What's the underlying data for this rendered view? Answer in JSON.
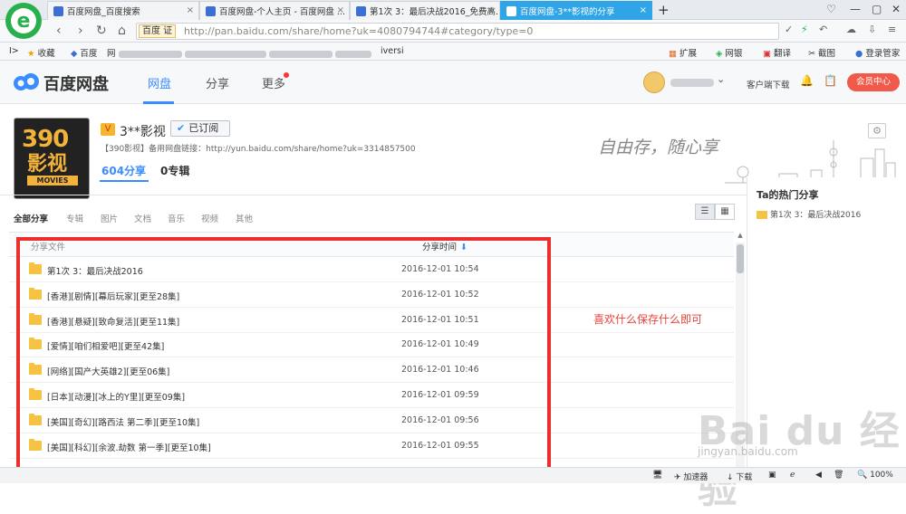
{
  "browser": {
    "tabs": [
      {
        "label": "百度网盘_百度搜索",
        "active": false
      },
      {
        "label": "百度网盘-个人主页 - 百度网盘 ...",
        "active": false
      },
      {
        "label": "第1次 3：最后决战2016_免费高...",
        "active": false
      },
      {
        "label": "百度网盘-3**影视的分享",
        "active": true
      }
    ],
    "new_tab": "+",
    "site_badge": "百度 证",
    "url": "http://pan.baidu.com/share/home?uk=4080794744#category/type=0",
    "bookmarks": {
      "toggle": "I>",
      "favorites": "收藏",
      "baidu": "百度",
      "net": "网",
      "universe": "iversi",
      "extensions": "扩展",
      "netbank": "网银",
      "translate": "翻译",
      "screenshot": "截图",
      "login_manager": "登录管家"
    }
  },
  "header": {
    "logo_text": "百度网盘",
    "nav": [
      "网盘",
      "分享",
      "更多"
    ],
    "client_download": "客户端下载",
    "vip_button": "会员中心"
  },
  "profile": {
    "cover_line1": "390",
    "cover_line2": "影视",
    "cover_line3": "MOVIES",
    "crown": "V",
    "name": "3**影视",
    "subscribe_label": "已订阅",
    "backup_link": "【390影视】备用网盘链接：http://yun.baidu.com/share/home?uk=3314857500",
    "share_count": "604分享",
    "album_count": "0专辑",
    "slogan": "自由存，随心享",
    "gear": "⚙"
  },
  "filters": [
    "全部分享",
    "专辑",
    "图片",
    "文档",
    "音乐",
    "视频",
    "其他"
  ],
  "table": {
    "col_file": "分享文件",
    "col_time": "分享时间",
    "sort_arrow": "⬇",
    "rows": [
      {
        "name": "第1次 3：最后决战2016",
        "time": "2016-12-01 10:54"
      },
      {
        "name": "[香港][剧情][幕后玩家][更至28集]",
        "time": "2016-12-01 10:52"
      },
      {
        "name": "[香港][悬疑][致命复活][更至11集]",
        "time": "2016-12-01 10:51"
      },
      {
        "name": "[爱情][咱们相爱吧][更至42集]",
        "time": "2016-12-01 10:49"
      },
      {
        "name": "[网络][国产大英雄2][更至06集]",
        "time": "2016-12-01 10:46"
      },
      {
        "name": "[日本][动漫][冰上的Y里][更至09集]",
        "time": "2016-12-01 09:59"
      },
      {
        "name": "[美国][奇幻][路西法 第二季][更至10集]",
        "time": "2016-12-01 09:56"
      },
      {
        "name": "[美国][科幻][余波.劫数 第一季][更至10集]",
        "time": "2016-12-01 09:55"
      }
    ]
  },
  "sidebar": {
    "title": "Ta的热门分享",
    "item": "第1次 3：最后决战2016"
  },
  "annotation": "喜欢什么保存什么即可",
  "watermark": {
    "logo": "Bai du 经验",
    "url": "jingyan.baidu.com"
  },
  "statusbar": {
    "accelerator": "加速器",
    "download": "下载",
    "zoom": "100%"
  },
  "colors": {
    "accent": "#3b8cff",
    "annotation_red": "#ee2d2d",
    "vip": "#f15a4a",
    "folder": "#f5c242"
  }
}
